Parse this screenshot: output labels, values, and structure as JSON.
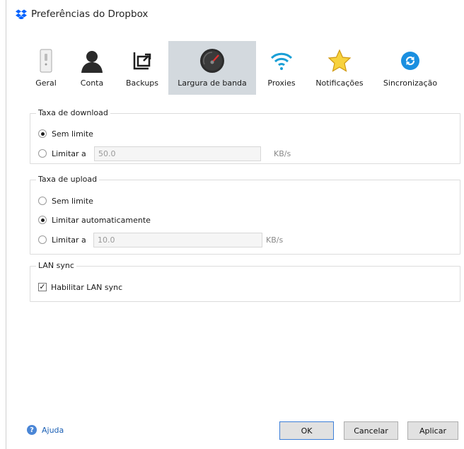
{
  "window": {
    "title": "Preferências do Dropbox",
    "logo_icon": "dropbox-logo-icon"
  },
  "tabs": [
    {
      "label": "Geral",
      "icon": "switch-icon",
      "active": false
    },
    {
      "label": "Conta",
      "icon": "person-icon",
      "active": false
    },
    {
      "label": "Backups",
      "icon": "backup-icon",
      "active": false
    },
    {
      "label": "Largura de banda",
      "icon": "speedometer-icon",
      "active": true
    },
    {
      "label": "Proxies",
      "icon": "wifi-icon",
      "active": false
    },
    {
      "label": "Notificações",
      "icon": "star-icon",
      "active": false
    },
    {
      "label": "Sincronização",
      "icon": "sync-icon",
      "active": false
    }
  ],
  "download": {
    "legend": "Taxa de download",
    "option_unlimited": "Sem limite",
    "option_limit": "Limitar a",
    "limit_value": "50.0",
    "unit": "KB/s",
    "selected": "Sem limite"
  },
  "upload": {
    "legend": "Taxa de upload",
    "option_unlimited": "Sem limite",
    "option_auto": "Limitar automaticamente",
    "option_limit": "Limitar a",
    "limit_value": "10.0",
    "unit": "KB/s",
    "selected": "Limitar automaticamente"
  },
  "lansync": {
    "legend": "LAN sync",
    "checkbox_label": "Habilitar LAN sync",
    "checked": true
  },
  "footer": {
    "help_label": "Ajuda",
    "ok_label": "OK",
    "cancel_label": "Cancelar",
    "apply_label": "Aplicar"
  },
  "colors": {
    "active_tab": "#d3d9de",
    "link": "#1a5fb4",
    "dropbox_blue": "#0061fe"
  }
}
